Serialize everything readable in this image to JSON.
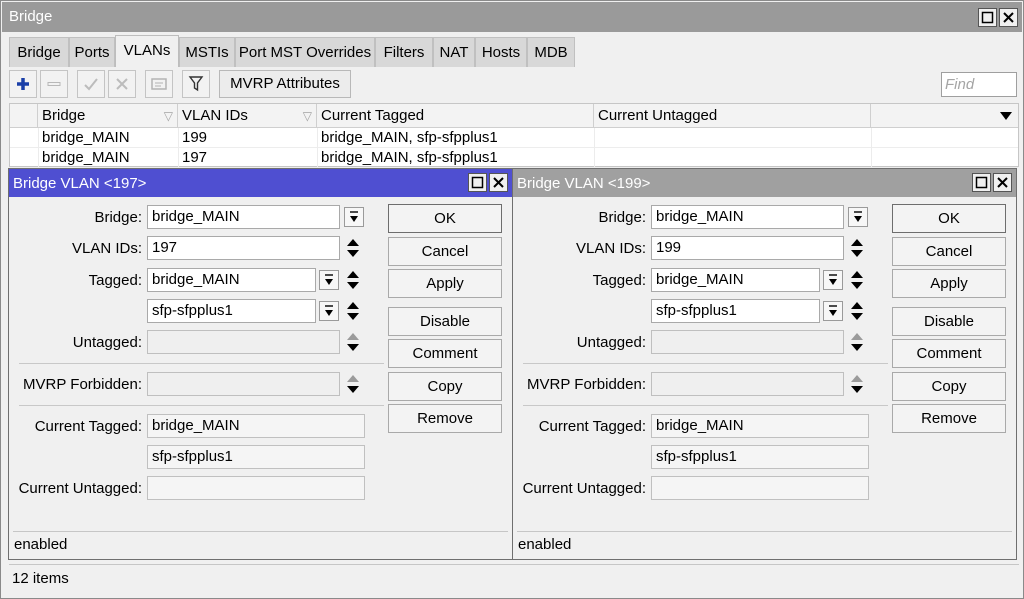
{
  "window": {
    "title": "Bridge"
  },
  "tabs": [
    "Bridge",
    "Ports",
    "VLANs",
    "MSTIs",
    "Port MST Overrides",
    "Filters",
    "NAT",
    "Hosts",
    "MDB"
  ],
  "toolbar": {
    "mvrp_label": "MVRP Attributes",
    "find_placeholder": "Find"
  },
  "table": {
    "columns": [
      "Bridge",
      "VLAN IDs",
      "Current Tagged",
      "Current Untagged"
    ],
    "rows": [
      {
        "bridge": "bridge_MAIN",
        "vlan_ids": "199",
        "current_tagged": "bridge_MAIN, sfp-sfpplus1",
        "current_untagged": ""
      },
      {
        "bridge": "bridge_MAIN",
        "vlan_ids": "197",
        "current_tagged": "bridge_MAIN, sfp-sfpplus1",
        "current_untagged": ""
      }
    ]
  },
  "labels": {
    "bridge": "Bridge:",
    "vlan_ids": "VLAN IDs:",
    "tagged": "Tagged:",
    "untagged": "Untagged:",
    "mvrp_forbidden": "MVRP Forbidden:",
    "current_tagged": "Current Tagged:",
    "current_untagged": "Current Untagged:"
  },
  "buttons": {
    "ok": "OK",
    "cancel": "Cancel",
    "apply": "Apply",
    "disable": "Disable",
    "comment": "Comment",
    "copy": "Copy",
    "remove": "Remove"
  },
  "dialogs": [
    {
      "title": "Bridge VLAN <197>",
      "bridge": "bridge_MAIN",
      "vlan_ids": "197",
      "tagged": [
        "bridge_MAIN",
        "sfp-sfpplus1"
      ],
      "untagged": "",
      "mvrp_forbidden": "",
      "current_tagged": [
        "bridge_MAIN",
        "sfp-sfpplus1"
      ],
      "current_untagged": "",
      "status": "enabled",
      "active": true
    },
    {
      "title": "Bridge VLAN <199>",
      "bridge": "bridge_MAIN",
      "vlan_ids": "199",
      "tagged": [
        "bridge_MAIN",
        "sfp-sfpplus1"
      ],
      "untagged": "",
      "mvrp_forbidden": "",
      "current_tagged": [
        "bridge_MAIN",
        "sfp-sfpplus1"
      ],
      "current_untagged": "",
      "status": "enabled",
      "active": false
    }
  ],
  "status": {
    "items_count": "12 items"
  },
  "colors": {
    "active_title": "#4f4fd1",
    "inactive_title": "#a0a0a0",
    "add_icon": "#1a3fa8"
  }
}
